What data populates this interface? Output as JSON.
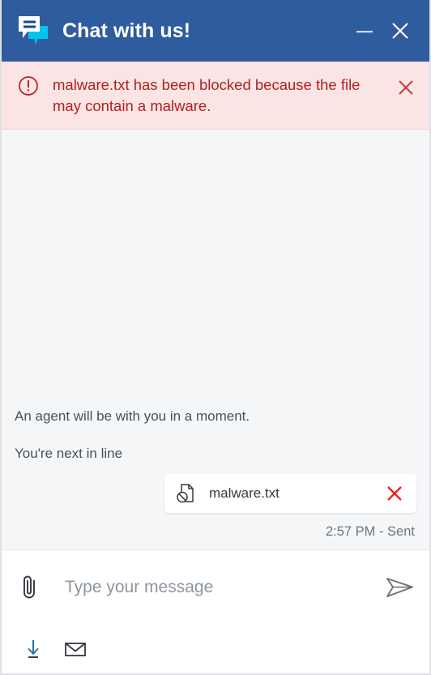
{
  "window": {
    "title": "Chat with us!",
    "brand_icon": "chat-bubbles-icon",
    "minimize_label": "Minimize",
    "close_label": "Close",
    "colors": {
      "header_bg": "#2f5c9e",
      "alert_bg": "#fbe4e4",
      "alert_text": "#b42020",
      "chat_bg": "#f5f6f8",
      "accent_cyan": "#00c6ef",
      "download_blue": "#1f6fa8",
      "danger_red": "#ef1c1c"
    }
  },
  "alert": {
    "icon": "exclamation-circle-icon",
    "message": "malware.txt has been blocked because the file may contain a malware.",
    "close_icon": "close-icon"
  },
  "chat": {
    "messages": [
      {
        "text": "An agent will be with you in a moment."
      },
      {
        "text": "You're next in line"
      }
    ],
    "attachment": {
      "icon": "blocked-file-icon",
      "filename": "malware.txt",
      "remove_icon": "close-icon"
    },
    "status": "2:57 PM - Sent"
  },
  "composer": {
    "attach_icon": "paperclip-icon",
    "placeholder": "Type your message",
    "value": "",
    "send_icon": "send-paper-plane-icon"
  },
  "footer": {
    "download_icon": "download-transcript-icon",
    "email_icon": "email-transcript-icon"
  }
}
